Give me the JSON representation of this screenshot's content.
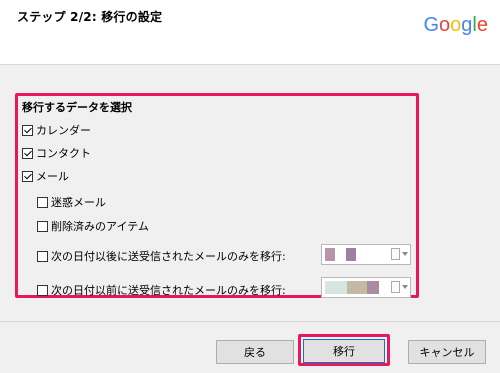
{
  "header": {
    "title": "ステップ 2/2: 移行の設定",
    "logo_letters": [
      {
        "char": "G",
        "color": "#4285F4"
      },
      {
        "char": "o",
        "color": "#EA4335"
      },
      {
        "char": "o",
        "color": "#FBBC05"
      },
      {
        "char": "g",
        "color": "#4285F4"
      },
      {
        "char": "l",
        "color": "#34A853"
      },
      {
        "char": "e",
        "color": "#EA4335"
      }
    ]
  },
  "section": {
    "title": "移行するデータを選択",
    "highlight_color": "#e8185a",
    "items": {
      "calendar": {
        "label": "カレンダー",
        "checked": true
      },
      "contacts": {
        "label": "コンタクト",
        "checked": true
      },
      "mail": {
        "label": "メール",
        "checked": true
      },
      "junk": {
        "label": "迷惑メール",
        "checked": false
      },
      "deleted": {
        "label": "削除済みのアイテム",
        "checked": false
      },
      "after_date": {
        "label": "次の日付以後に送受信されたメールのみを移行:",
        "checked": false
      },
      "before_date": {
        "label": "次の日付以前に送受信されたメールのみを移行:",
        "checked": false
      }
    }
  },
  "buttons": {
    "back": "戻る",
    "migrate": "移行",
    "cancel": "キャンセル"
  }
}
